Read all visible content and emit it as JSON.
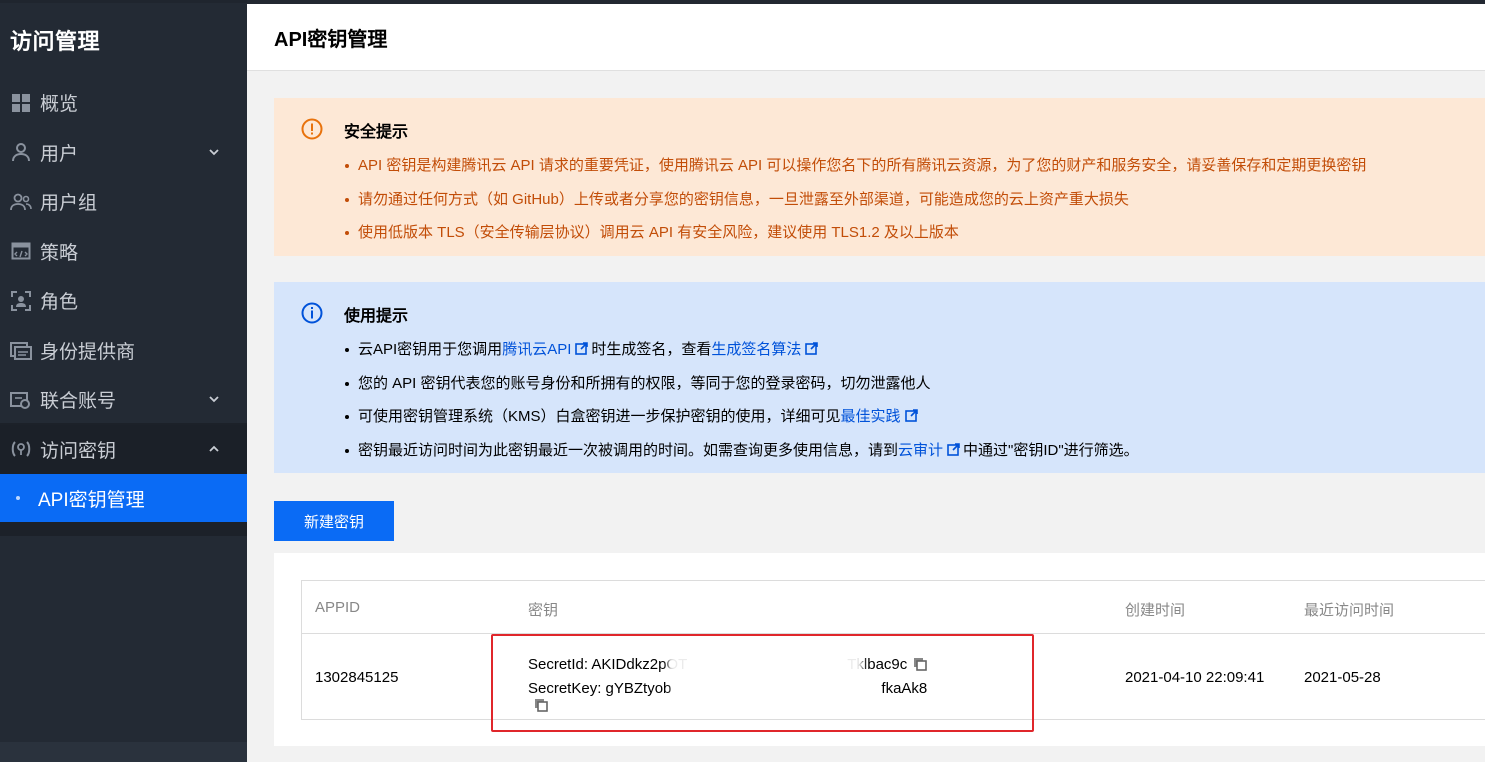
{
  "sidebar": {
    "title": "访问管理",
    "items": [
      {
        "label": "概览",
        "icon": "dashboard-icon"
      },
      {
        "label": "用户",
        "icon": "user-icon",
        "expandable": true
      },
      {
        "label": "用户组",
        "icon": "users-icon"
      },
      {
        "label": "策略",
        "icon": "policy-icon"
      },
      {
        "label": "角色",
        "icon": "role-icon"
      },
      {
        "label": "身份提供商",
        "icon": "identity-provider-icon"
      },
      {
        "label": "联合账号",
        "icon": "federated-account-icon",
        "expandable": true
      },
      {
        "label": "访问密钥",
        "icon": "access-key-icon",
        "expanded": true
      }
    ],
    "active_sub_item": "API密钥管理"
  },
  "header": {
    "title": "API密钥管理"
  },
  "security_notice": {
    "title": "安全提示",
    "items": [
      "API 密钥是构建腾讯云 API 请求的重要凭证，使用腾讯云 API 可以操作您名下的所有腾讯云资源，为了您的财产和服务安全，请妥善保存和定期更换密钥",
      "请勿通过任何方式（如 GitHub）上传或者分享您的密钥信息，一旦泄露至外部渠道，可能造成您的云上资产重大损失",
      "使用低版本 TLS（安全传输层协议）调用云 API 有安全风险，建议使用 TLS1.2 及以上版本"
    ]
  },
  "usage_notice": {
    "title": "使用提示",
    "item1": {
      "prefix": "云API密钥用于您调用",
      "link1": "腾讯云API",
      "middle": "时生成签名，查看",
      "link2": "生成签名算法"
    },
    "item2": "您的 API 密钥代表您的账号身份和所拥有的权限，等同于您的登录密码，切勿泄露他人",
    "item3": {
      "prefix": "可使用密钥管理系统（KMS）白盒密钥进一步保护密钥的使用，详细可见",
      "link": "最佳实践"
    },
    "item4": {
      "prefix": "密钥最近访问时间为此密钥最近一次被调用的时间。如需查询更多使用信息，请到",
      "link": "云审计",
      "suffix": "中通过\"密钥ID\"进行筛选。"
    }
  },
  "new_key_button": "新建密钥",
  "table": {
    "headers": [
      "APPID",
      "密钥",
      "创建时间",
      "最近访问时间"
    ],
    "rows": [
      {
        "appid": "1302845125",
        "secret_id": "SecretId: AKIDdkz2pOT",
        "secret_id_tail": "Tklbac9c",
        "secret_key": "SecretKey: gYBZtyob",
        "secret_key_tail": "fkaAk8",
        "created": "2021-04-10 22:09:41",
        "last_access": "2021-05-28"
      }
    ]
  },
  "colors": {
    "accent": "#0a6bf5",
    "warning_bg": "#fde8d6",
    "warning_text": "#c24d08",
    "info_bg": "#d6e5fb",
    "link": "#0052d9",
    "highlight_box": "#e0262b"
  }
}
